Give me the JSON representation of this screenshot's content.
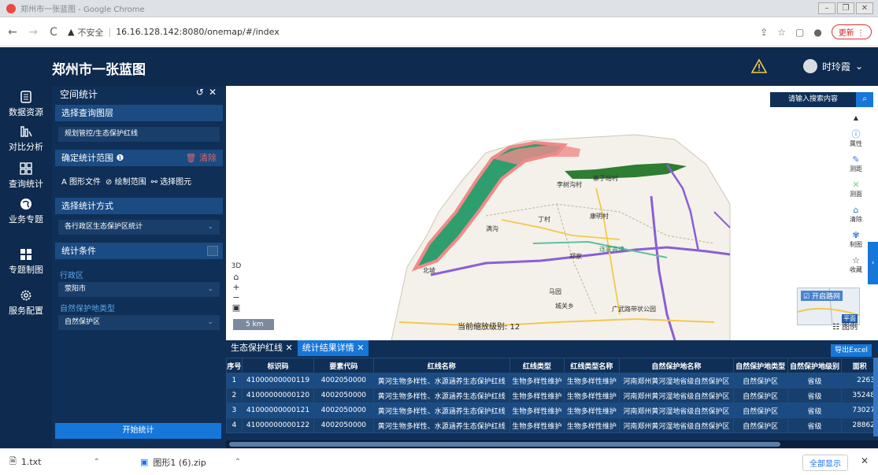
{
  "browser": {
    "window_title": "郑州市一张蓝图 - Google Chrome",
    "insecure_label": "不安全",
    "url": "16.16.128.142:8080/onemap/#/index",
    "update_label": "更新"
  },
  "app": {
    "title": "郑州市一张蓝图",
    "user": "时玲霞"
  },
  "leftnav": {
    "items": [
      {
        "label": "数据资源",
        "icon": "document-icon"
      },
      {
        "label": "对比分析",
        "icon": "compare-icon"
      },
      {
        "label": "查询统计",
        "icon": "grid-icon"
      },
      {
        "label": "业务专题",
        "icon": "globe-icon"
      },
      {
        "label": "专题制图",
        "icon": "map-make-icon"
      },
      {
        "label": "服务配置",
        "icon": "gear-icon"
      }
    ]
  },
  "panel": {
    "title": "空间统计",
    "sec_layer": "选择查询图层",
    "layer_value": "规划管控/生态保护红线",
    "sec_range": "确定统计范围",
    "clear_label": "清除",
    "tool_file": "图形文件",
    "tool_draw": "绘制范围",
    "tool_select": "选择图元",
    "sec_method": "选择统计方式",
    "method_value": "各行政区生态保护区统计",
    "sec_condition": "统计条件",
    "region_label": "行政区",
    "region_value": "荥阳市",
    "type_label": "自然保护地类型",
    "type_value": "自然保护区",
    "start_label": "开始统计"
  },
  "map": {
    "search_placeholder": "请输入搜索内容",
    "tools": [
      {
        "label": "属性",
        "icon": "info-icon"
      },
      {
        "label": "测距",
        "icon": "measure-distance-icon"
      },
      {
        "label": "测面",
        "icon": "measure-area-icon"
      },
      {
        "label": "清除",
        "icon": "eraser-icon"
      },
      {
        "label": "制图",
        "icon": "draw-icon"
      },
      {
        "label": "收藏",
        "icon": "star-icon"
      }
    ],
    "mode_3d": "3D",
    "scale": "5 km",
    "zoom_level": "当前缩放级别: 12",
    "basemap_label": "开启路网",
    "basemap_tag": "平面",
    "legend_label": "图例",
    "place_labels": [
      "李树沟村",
      "寨子峪村",
      "丁村",
      "满沟",
      "康明村",
      "郑家",
      "北坡",
      "连霍高速",
      "马园",
      "城关乡",
      "广武路带状公园"
    ],
    "colors": {
      "red_line_zone": "#f08a8a",
      "green_zone": "#2f9e6e",
      "forest": "#2e7d32",
      "road_purple": "#8a5fd6",
      "road_yellow": "#f2c94c"
    }
  },
  "results": {
    "tabs": [
      "生态保护红线",
      "统计结果详情"
    ],
    "export_label": "导出Excel",
    "headers": [
      "序号",
      "标识码",
      "要素代码",
      "红线名称",
      "红线类型",
      "红线类型名称",
      "自然保护地名称",
      "自然保护地类型",
      "自然保护地级别",
      "面积"
    ],
    "rows": [
      [
        "1",
        "41000000000119",
        "4002050000",
        "黄河生物多样性、水源涵养生态保护红线",
        "生物多样性维护",
        "生物多样性维护",
        "河南郑州黄河湿地省级自然保护区",
        "自然保护区",
        "省级",
        "2263"
      ],
      [
        "2",
        "41000000000120",
        "4002050000",
        "黄河生物多样性、水源涵养生态保护红线",
        "生物多样性维护",
        "生物多样性维护",
        "河南郑州黄河湿地省级自然保护区",
        "自然保护区",
        "省级",
        "35248"
      ],
      [
        "3",
        "41000000000121",
        "4002050000",
        "黄河生物多样性、水源涵养生态保护红线",
        "生物多样性维护",
        "生物多样性维护",
        "河南郑州黄河湿地省级自然保护区",
        "自然保护区",
        "省级",
        "73027"
      ],
      [
        "4",
        "41000000000122",
        "4002050000",
        "黄河生物多样性、水源涵养生态保护红线",
        "生物多样性维护",
        "生物多样性维护",
        "河南郑州黄河湿地省级自然保护区",
        "自然保护区",
        "省级",
        "28862"
      ]
    ]
  },
  "downloads": {
    "file1": "1.txt",
    "file2": "图形1 (6).zip",
    "show_all": "全部显示"
  }
}
